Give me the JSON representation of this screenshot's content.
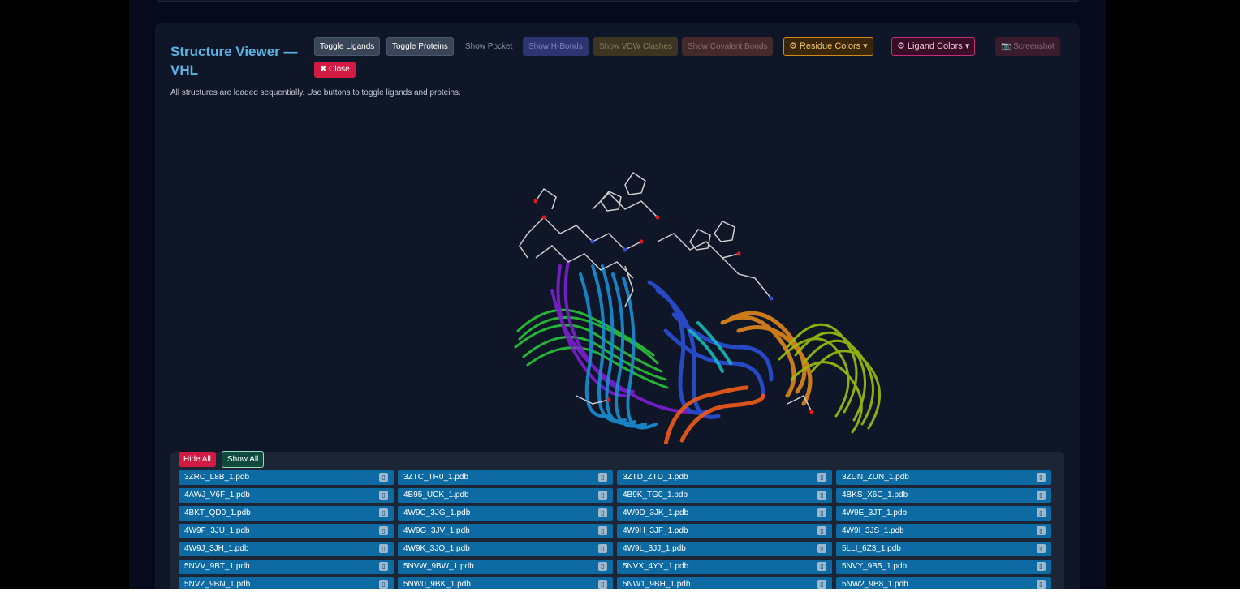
{
  "viewer": {
    "title": "Structure Viewer — VHL",
    "subtitle": "All structures are loaded sequentially. Use buttons to toggle ligands and proteins."
  },
  "toolbar": {
    "toggle_ligands": "Toggle Ligands",
    "toggle_proteins": "Toggle Proteins",
    "show_pocket": "Show Pocket",
    "show_hbonds": "Show H-Bonds",
    "show_vdw": "Show VDW Clashes",
    "show_covalent": "Show Covalent Bonds",
    "residue_colors": "⚙ Residue Colors ▾",
    "ligand_colors": "⚙ Ligand Colors ▾",
    "screenshot": "📷 Screenshot",
    "close": "✖ Close"
  },
  "list": {
    "hide_all": "Hide All",
    "show_all": "Show All",
    "files": [
      "3ZRC_L8B_1.pdb",
      "3ZTC_TR0_1.pdb",
      "3ZTD_ZTD_1.pdb",
      "3ZUN_ZUN_1.pdb",
      "4AWJ_V6F_1.pdb",
      "4B95_UCK_1.pdb",
      "4B9K_TG0_1.pdb",
      "4BKS_X6C_1.pdb",
      "4BKT_QD0_1.pdb",
      "4W9C_3JG_1.pdb",
      "4W9D_3JK_1.pdb",
      "4W9E_3JT_1.pdb",
      "4W9F_3JU_1.pdb",
      "4W9G_3JV_1.pdb",
      "4W9H_3JF_1.pdb",
      "4W9I_3JS_1.pdb",
      "4W9J_3JH_1.pdb",
      "4W9K_3JO_1.pdb",
      "4W9L_3JJ_1.pdb",
      "5LLI_6Z3_1.pdb",
      "5NVV_9BT_1.pdb",
      "5NVW_9BW_1.pdb",
      "5NVX_4YY_1.pdb",
      "5NVY_9B5_1.pdb",
      "5NVZ_9BN_1.pdb",
      "5NW0_9BK_1.pdb",
      "5NW1_9BH_1.pdb",
      "5NW2_9B8_1.pdb"
    ],
    "item_icon": "toggle-visibility-icon"
  },
  "colors": {
    "accent_title": "#5ab4e4",
    "file_item": "#0d6aa3",
    "danger": "#d11b43",
    "success": "#0f4a3c"
  }
}
